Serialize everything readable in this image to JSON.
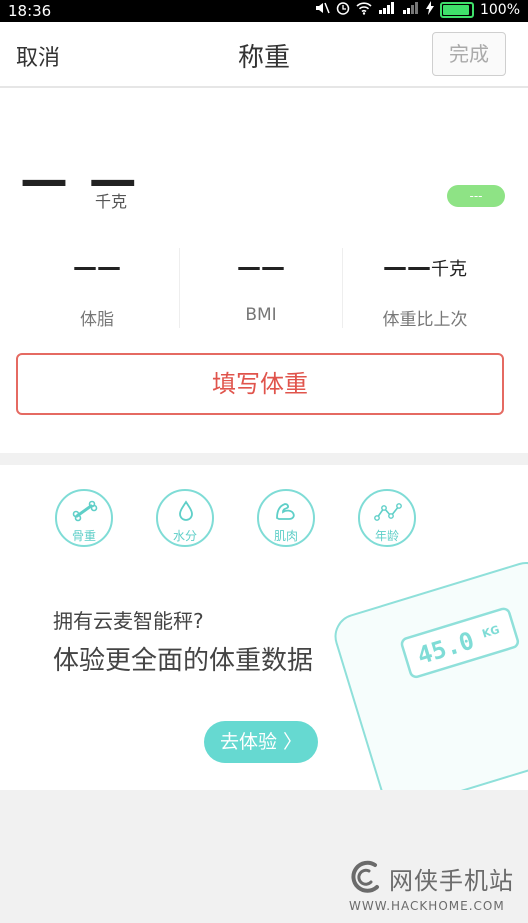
{
  "status_bar": {
    "time": "18:36",
    "battery": "100%",
    "battery_level": 1.0,
    "icons": [
      "mute-icon",
      "alarm-icon",
      "wifi-icon",
      "signal-icon",
      "signal-icon",
      "charging-icon"
    ]
  },
  "header": {
    "cancel_label": "取消",
    "title": "称重",
    "done_label": "完成"
  },
  "weight": {
    "value": "— —",
    "unit": "千克",
    "status_badge": "---"
  },
  "stats": [
    {
      "value": "——",
      "unit": "",
      "label": "体脂"
    },
    {
      "value": "——",
      "unit": "",
      "label": "BMI"
    },
    {
      "value": "——",
      "unit": "千克",
      "label": "体重比上次"
    }
  ],
  "fill_button_label": "填写体重",
  "promo": {
    "features": [
      {
        "label": "骨重",
        "icon": "bone-icon"
      },
      {
        "label": "水分",
        "icon": "water-drop-icon"
      },
      {
        "label": "肌肉",
        "icon": "muscle-icon"
      },
      {
        "label": "年龄",
        "icon": "age-curve-icon"
      }
    ],
    "question": "拥有云麦智能秤?",
    "headline": "体验更全面的体重数据",
    "try_button_label": "去体验 〉",
    "scale_display": "45.0",
    "scale_unit": "KG"
  },
  "watermark": {
    "name": "网侠手机站",
    "url": "WWW.HACKHOME.COM"
  },
  "colors": {
    "accent_red": "#e56a62",
    "teal": "#66d9d1",
    "badge_green": "#8ee385"
  }
}
